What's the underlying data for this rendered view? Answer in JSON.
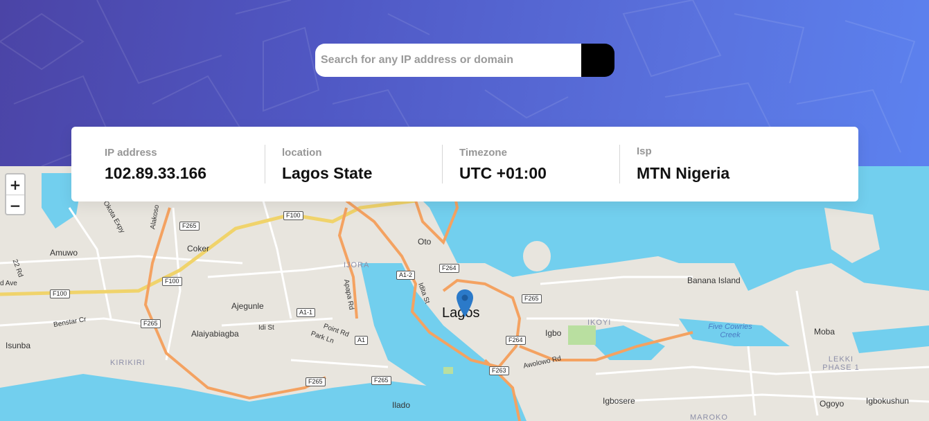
{
  "search": {
    "placeholder": "Search for any IP address or domain",
    "value": ""
  },
  "stats": [
    {
      "label": "IP address",
      "value": "102.89.33.166"
    },
    {
      "label": "location",
      "value": "Lagos State"
    },
    {
      "label": "Timezone",
      "value": "UTC +01:00"
    },
    {
      "label": "Isp",
      "value": "MTN Nigeria"
    }
  ],
  "zoom": {
    "in": "+",
    "out": "−"
  },
  "map": {
    "city": "Lagos",
    "places": [
      "Amuwo",
      "Coker",
      "Oto",
      "Ajegunle",
      "Alaiyabiagba",
      "Isunba",
      "Igbo",
      "Banana Island",
      "Moba",
      "Ilado",
      "Igbosere",
      "Ogoyo",
      "Igbokushun"
    ],
    "districts": [
      "IJORA",
      "IKOYI",
      "KIRIKIRI",
      "LEKKI PHASE 1",
      "MAROKO"
    ],
    "water": [
      "Five Cowries Creek"
    ],
    "roads": [
      "Apapa Rd",
      "Idita St",
      "Point Rd",
      "Park Ln",
      "Benstar Cr",
      "Idi St",
      "Awolowo Rd",
      "22 Rd",
      "d Ave",
      "go Okota Expy",
      "Alakoso"
    ],
    "route_shields": [
      "F265",
      "F100",
      "F264",
      "A1-2",
      "A1-1",
      "A1",
      "F263"
    ],
    "water_color": "#72cfee",
    "land_color": "#e8e5de",
    "major_road_color": "#f4a261",
    "trunk_road_color": "#f0d36b",
    "marker_color": "#2b7ac9"
  },
  "icons": {
    "submit": "chevron-right-icon",
    "marker": "map-pin-icon"
  }
}
